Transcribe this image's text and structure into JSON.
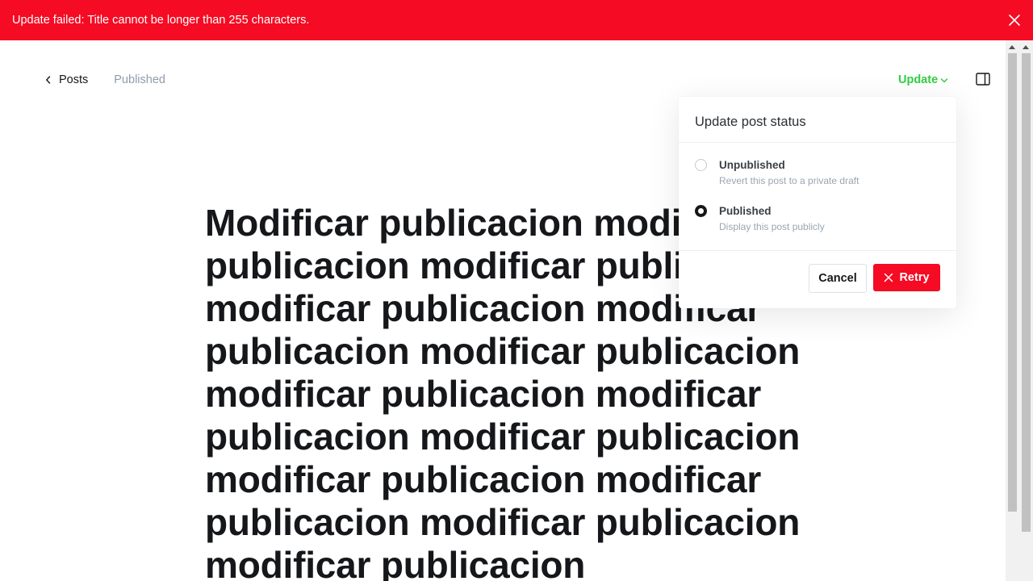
{
  "alert": {
    "message": "Update failed: Title cannot be longer than 255 characters."
  },
  "header": {
    "back_label": "Posts",
    "status": "Published",
    "update_label": "Update"
  },
  "post": {
    "title": "Modificar publicacion modificar publicacion modificar publicacion modificar publicacion modificar publicacion modificar publicacion modificar publicacion modificar publicacion modificar publicacion modificar publicacion modificar publicacion modificar publicacion modificar publicacion"
  },
  "popover": {
    "title": "Update post status",
    "options": [
      {
        "label": "Unpublished",
        "description": "Revert this post to a private draft",
        "selected": false
      },
      {
        "label": "Published",
        "description": "Display this post publicly",
        "selected": true
      }
    ],
    "cancel_label": "Cancel",
    "retry_label": "Retry"
  },
  "colors": {
    "alert_red": "#f50b23",
    "update_green": "#30cf43",
    "text_dark": "#15171a",
    "muted": "#8e9cac"
  },
  "icons": [
    "close-icon",
    "chevron-left-icon",
    "chevron-down-icon",
    "sidebar-toggle-icon",
    "x-icon"
  ]
}
